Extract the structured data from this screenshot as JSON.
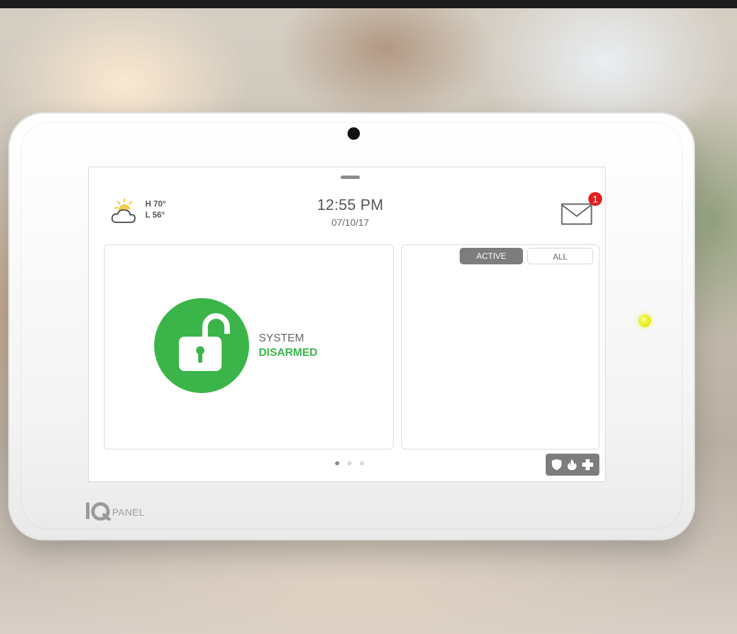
{
  "device": {
    "brand_text": "PANEL",
    "led_color": "#e3e600"
  },
  "weather": {
    "icon": "partly-sunny-icon",
    "high": "H 70°",
    "low": "L 56°"
  },
  "clock": {
    "time": "12:55 PM",
    "date": "07/10/17"
  },
  "messages": {
    "icon": "envelope-icon",
    "unread_count": "1"
  },
  "status": {
    "icon": "unlocked-padlock-icon",
    "line1": "SYSTEM",
    "line2": "DISARMED",
    "color": "#3bb54a"
  },
  "activity": {
    "tabs": [
      {
        "label": "ACTIVE",
        "selected": true
      },
      {
        "label": "ALL",
        "selected": false
      }
    ]
  },
  "pager": {
    "total": 3,
    "current": 1
  },
  "emergency": {
    "icons": [
      "shield-icon",
      "fire-icon",
      "medical-cross-icon"
    ]
  }
}
